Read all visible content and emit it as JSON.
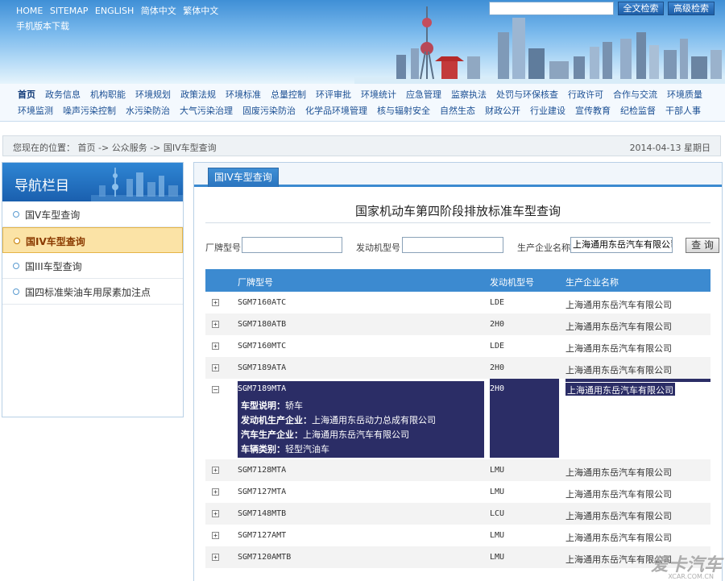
{
  "header": {
    "top_links": [
      "HOME",
      "SITEMAP",
      "ENGLISH",
      "简体中文",
      "繁体中文"
    ],
    "mobile_link": "手机版本下载",
    "search": {
      "value": "",
      "fulltext_button": "全文检索",
      "advanced_button": "高级检索"
    }
  },
  "nav": {
    "row1": [
      "首页",
      "政务信息",
      "机构职能",
      "环境规划",
      "政策法规",
      "环境标准",
      "总量控制",
      "环评审批",
      "环境统计",
      "应急管理",
      "监察执法",
      "处罚与环保核查",
      "行政许可",
      "合作与交流",
      "环境质量"
    ],
    "row2": [
      "环境监测",
      "噪声污染控制",
      "水污染防治",
      "大气污染治理",
      "固废污染防治",
      "化学品环境管理",
      "核与辐射安全",
      "自然生态",
      "财政公开",
      "行业建设",
      "宣传教育",
      "纪检监督",
      "干部人事"
    ]
  },
  "location": {
    "prefix": "您现在的位置：",
    "crumbs": [
      "首页",
      "公众服务",
      "国IV车型查询"
    ],
    "separator": "->",
    "date": "2014-04-13 星期日"
  },
  "sidebar": {
    "title": "导航栏目",
    "items": [
      {
        "label": "国V车型查询",
        "active": false
      },
      {
        "label": "国IV车型查询",
        "active": true
      },
      {
        "label": "国III车型查询",
        "active": false
      },
      {
        "label": "国四标准柴油车用尿素加注点",
        "active": false
      }
    ]
  },
  "main": {
    "tab": "国IV车型查询",
    "title": "国家机动车第四阶段排放标准车型查询",
    "form": {
      "model_label": "厂牌型号",
      "model_value": "",
      "engine_label": "发动机型号",
      "engine_value": "",
      "maker_label": "生产企业名称",
      "maker_value": "上海通用东岳汽车有限公司",
      "query_button": "查 询"
    },
    "table": {
      "headers": [
        "厂牌型号",
        "发动机型号",
        "生产企业名称"
      ],
      "rows_top": [
        {
          "model": "SGM7160ATC",
          "engine": "LDE",
          "maker": "上海通用东岳汽车有限公司"
        },
        {
          "model": "SGM7180ATB",
          "engine": "2H0",
          "maker": "上海通用东岳汽车有限公司"
        },
        {
          "model": "SGM7160MTC",
          "engine": "LDE",
          "maker": "上海通用东岳汽车有限公司"
        },
        {
          "model": "SGM7189ATA",
          "engine": "2H0",
          "maker": "上海通用东岳汽车有限公司"
        }
      ],
      "expanded": {
        "model": "SGM7189MTA",
        "engine": "2H0",
        "maker": "上海通用东岳汽车有限公司",
        "details": [
          {
            "key": "车型说明：",
            "value": "轿车"
          },
          {
            "key": "发动机生产企业：",
            "value": "上海通用东岳动力总成有限公司"
          },
          {
            "key": "汽车生产企业：",
            "value": "上海通用东岳汽车有限公司"
          },
          {
            "key": "车辆类别：",
            "value": "轻型汽油车"
          }
        ]
      },
      "rows_bottom": [
        {
          "model": "SGM7128MTA",
          "engine": "LMU",
          "maker": "上海通用东岳汽车有限公司"
        },
        {
          "model": "SGM7127MTA",
          "engine": "LMU",
          "maker": "上海通用东岳汽车有限公司"
        },
        {
          "model": "SGM7148MTB",
          "engine": "LCU",
          "maker": "上海通用东岳汽车有限公司"
        },
        {
          "model": "SGM7127AMT",
          "engine": "LMU",
          "maker": "上海通用东岳汽车有限公司"
        },
        {
          "model": "SGM7120AMTB",
          "engine": "LMU",
          "maker": "上海通用东岳汽车有限公司"
        }
      ]
    }
  },
  "watermark": {
    "main": "爱卡汽车",
    "sub": "XCAR.COM.CN"
  },
  "colors": {
    "accent": "#3c8ad0",
    "highlight": "#2b2d66",
    "active_item": "#fbe3a6"
  }
}
